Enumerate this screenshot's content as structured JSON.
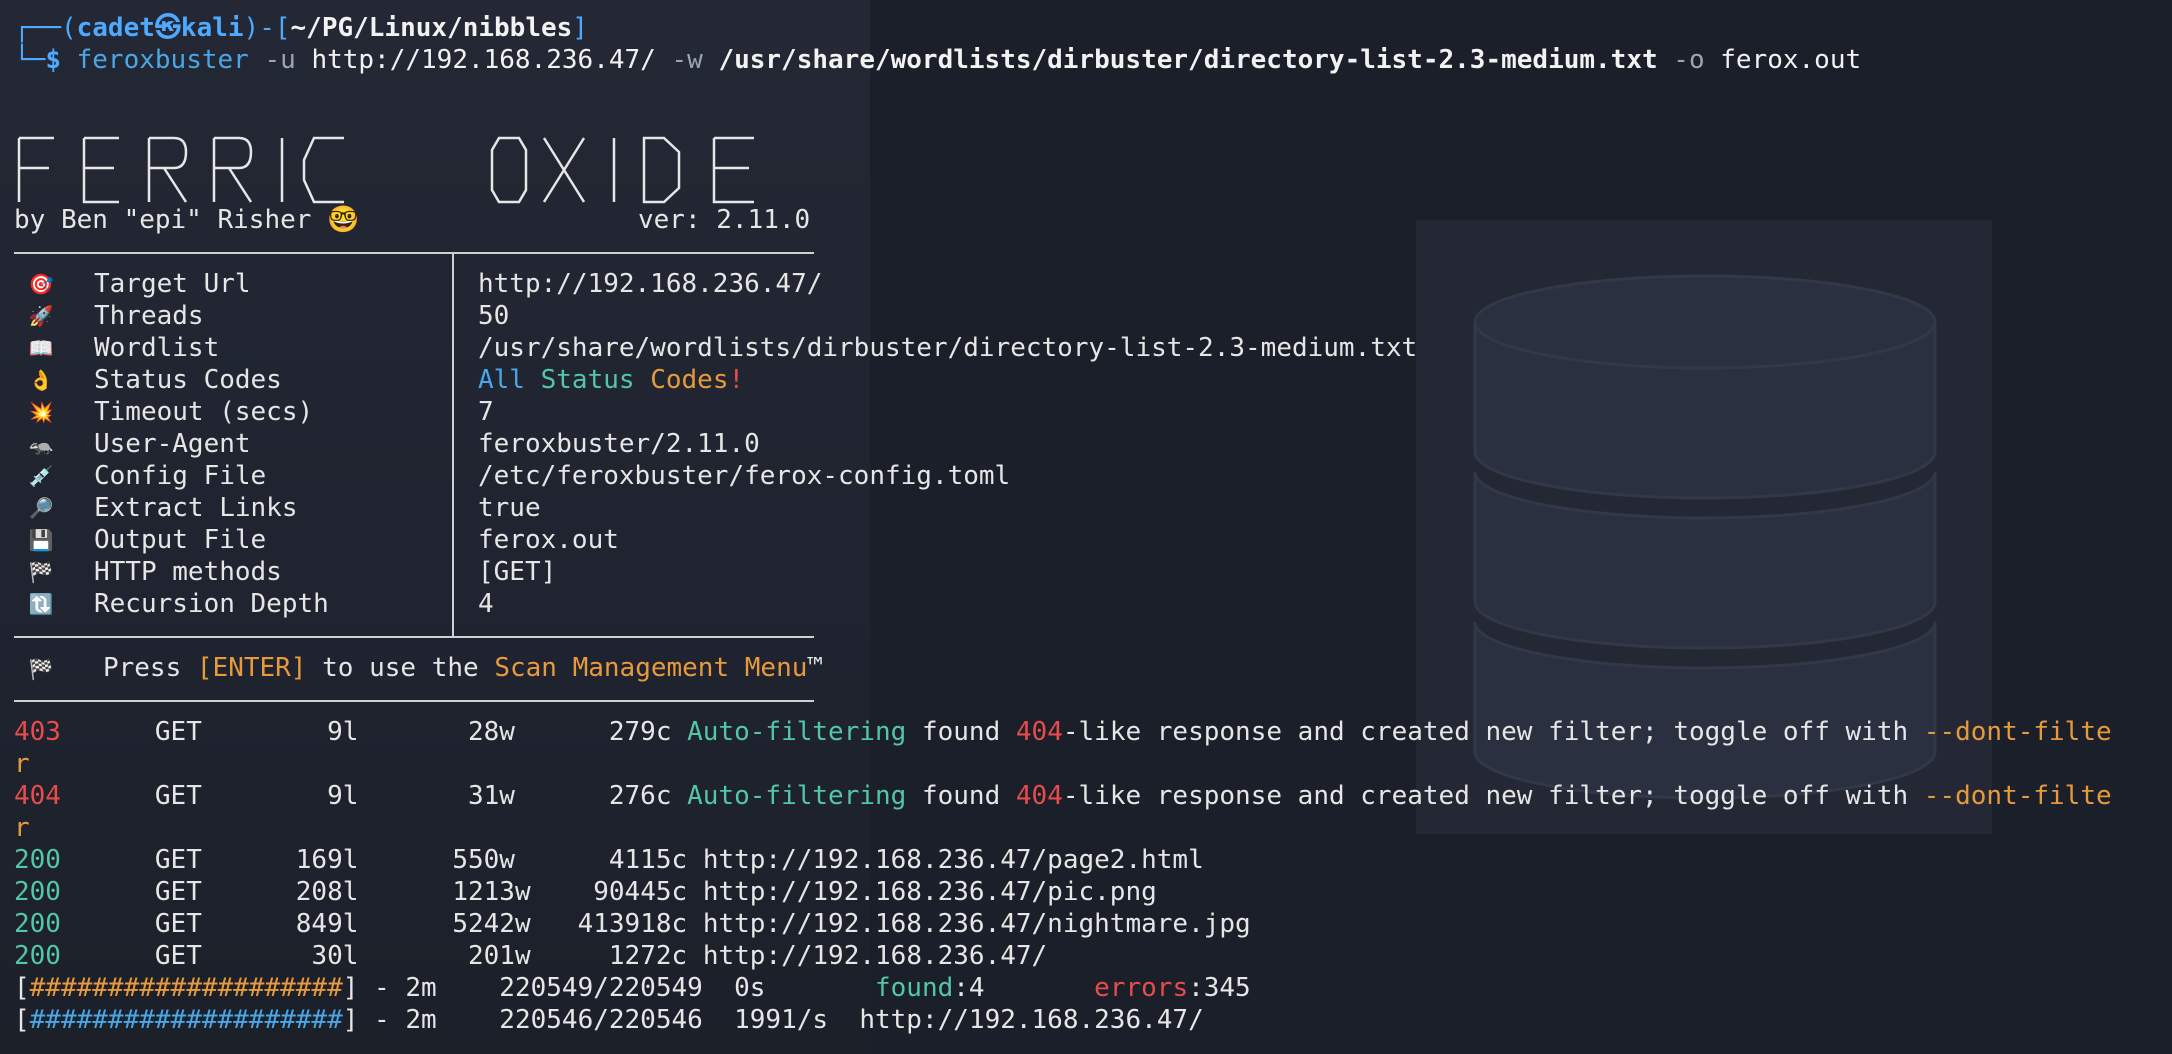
{
  "prompt": {
    "top_corner": "┌──",
    "user": "cadet",
    "at": "㉿",
    "host": "kali",
    "path": "~/PG/Linux/nibbles",
    "bottom_corner": "└─",
    "dollar": "$"
  },
  "command": {
    "bin": "feroxbuster",
    "flag_u": "-u",
    "url": "http://192.168.236.47/",
    "flag_w": "-w",
    "wordlist": "/usr/share/wordlists/dirbuster/directory-list-2.3-medium.txt",
    "flag_o": "-o",
    "outfile": "ferox.out"
  },
  "banner": {
    "author": "by Ben \"epi\" Risher 🤓",
    "version": "ver: 2.11.0"
  },
  "config": [
    {
      "icon": "🎯",
      "icon_name": "target-icon",
      "label": "Target Url",
      "value": "http://192.168.236.47/"
    },
    {
      "icon": "🚀",
      "icon_name": "rocket-icon",
      "label": "Threads",
      "value": "50"
    },
    {
      "icon": "📖",
      "icon_name": "book-icon",
      "label": "Wordlist",
      "value": "/usr/share/wordlists/dirbuster/directory-list-2.3-medium.txt"
    },
    {
      "icon": "👌",
      "icon_name": "ok-hand-icon",
      "label": "Status Codes",
      "value": ""
    },
    {
      "icon": "💥",
      "icon_name": "timeout-icon",
      "label": "Timeout (secs)",
      "value": "7"
    },
    {
      "icon": "🦡",
      "icon_name": "badger-icon",
      "label": "User-Agent",
      "value": "feroxbuster/2.11.0"
    },
    {
      "icon": "💉",
      "icon_name": "syringe-icon",
      "label": "Config File",
      "value": "/etc/feroxbuster/ferox-config.toml"
    },
    {
      "icon": "🔎",
      "icon_name": "magnifier-icon",
      "label": "Extract Links",
      "value": "true"
    },
    {
      "icon": "💾",
      "icon_name": "floppy-icon",
      "label": "Output File",
      "value": "ferox.out"
    },
    {
      "icon": "🏁",
      "icon_name": "checkered-flag-icon",
      "label": "HTTP methods",
      "value": "[GET]"
    },
    {
      "icon": "🔃",
      "icon_name": "recursion-icon",
      "label": "Recursion Depth",
      "value": "4"
    }
  ],
  "status_codes": {
    "w1": "All",
    "w2": "Status",
    "w3": "Codes",
    "bang": "!"
  },
  "press": {
    "icon": "🏁",
    "pre": "Press ",
    "key": "[ENTER]",
    "mid": " to use the ",
    "menu": "Scan Management Menu",
    "tm": "™"
  },
  "filters": [
    {
      "code": "403",
      "method": "GET",
      "lines": "9l",
      "words": "28w",
      "chars": "279c",
      "auto": "Auto-filtering",
      "found": " found ",
      "code404": "404",
      "rest": "-like response and created new filter; toggle off with ",
      "flag": "--dont-filte",
      "wrap": "r"
    },
    {
      "code": "404",
      "method": "GET",
      "lines": "9l",
      "words": "31w",
      "chars": "276c",
      "auto": "Auto-filtering",
      "found": " found ",
      "code404": "404",
      "rest": "-like response and created new filter; toggle off with ",
      "flag": "--dont-filte",
      "wrap": "r"
    }
  ],
  "results": [
    {
      "code": "200",
      "method": "GET",
      "lines": "169l",
      "words": "550w",
      "chars": "4115c",
      "url": "http://192.168.236.47/page2.html"
    },
    {
      "code": "200",
      "method": "GET",
      "lines": "208l",
      "words": "1213w",
      "chars": "90445c",
      "url": "http://192.168.236.47/pic.png"
    },
    {
      "code": "200",
      "method": "GET",
      "lines": "849l",
      "words": "5242w",
      "chars": "413918c",
      "url": "http://192.168.236.47/nightmare.jpg"
    },
    {
      "code": "200",
      "method": "GET",
      "lines": "30l",
      "words": "201w",
      "chars": "1272c",
      "url": "http://192.168.236.47/"
    }
  ],
  "progress": [
    {
      "bar": "####################",
      "time": "2m",
      "count": "220549/220549",
      "rate": "0s",
      "found_label": "found",
      "found": ":4",
      "errors_label": "errors",
      "errors": ":345",
      "color": "#e79a3c"
    },
    {
      "bar": "####################",
      "time": "2m",
      "count": "220546/220546",
      "rate": "1991/s",
      "url": "http://192.168.236.47/",
      "color": "#4aa6e6"
    }
  ]
}
